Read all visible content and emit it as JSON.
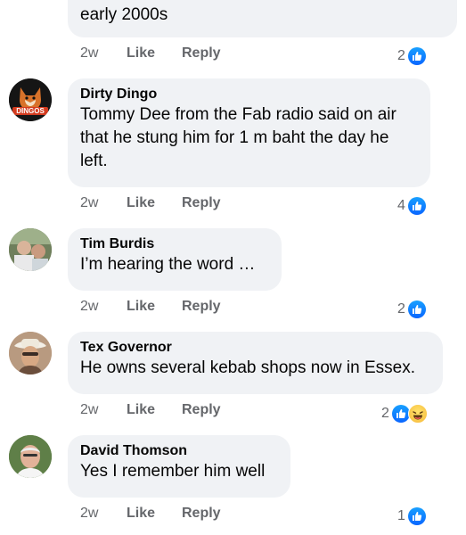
{
  "comments": [
    {
      "text": "early 2000s",
      "time": "2w",
      "like": "Like",
      "reply": "Reply",
      "reaction_count": "2",
      "reactions": [
        "like"
      ]
    },
    {
      "author": "Dirty Dingo",
      "text": "Tommy Dee from the Fab radio said on air that he stung him for 1 m baht the day he left.",
      "avatar_text": "DINGOS",
      "time": "2w",
      "like": "Like",
      "reply": "Reply",
      "reaction_count": "4",
      "reactions": [
        "like"
      ]
    },
    {
      "author": "Tim Burdis",
      "text": "I’m hearing the word …",
      "time": "2w",
      "like": "Like",
      "reply": "Reply",
      "reaction_count": "2",
      "reactions": [
        "like"
      ]
    },
    {
      "author": "Tex Governor",
      "text": "He owns several kebab shops now in Essex.",
      "time": "2w",
      "like": "Like",
      "reply": "Reply",
      "reaction_count": "2",
      "reactions": [
        "like",
        "haha"
      ]
    },
    {
      "author": "David Thomson",
      "text": "Yes I remember him well",
      "time": "2w",
      "like": "Like",
      "reply": "Reply",
      "reaction_count": "1",
      "reactions": [
        "like"
      ]
    }
  ],
  "colors": {
    "bubble": "#f0f2f5",
    "meta": "#65676b",
    "like_blue": "#0a66ff"
  }
}
